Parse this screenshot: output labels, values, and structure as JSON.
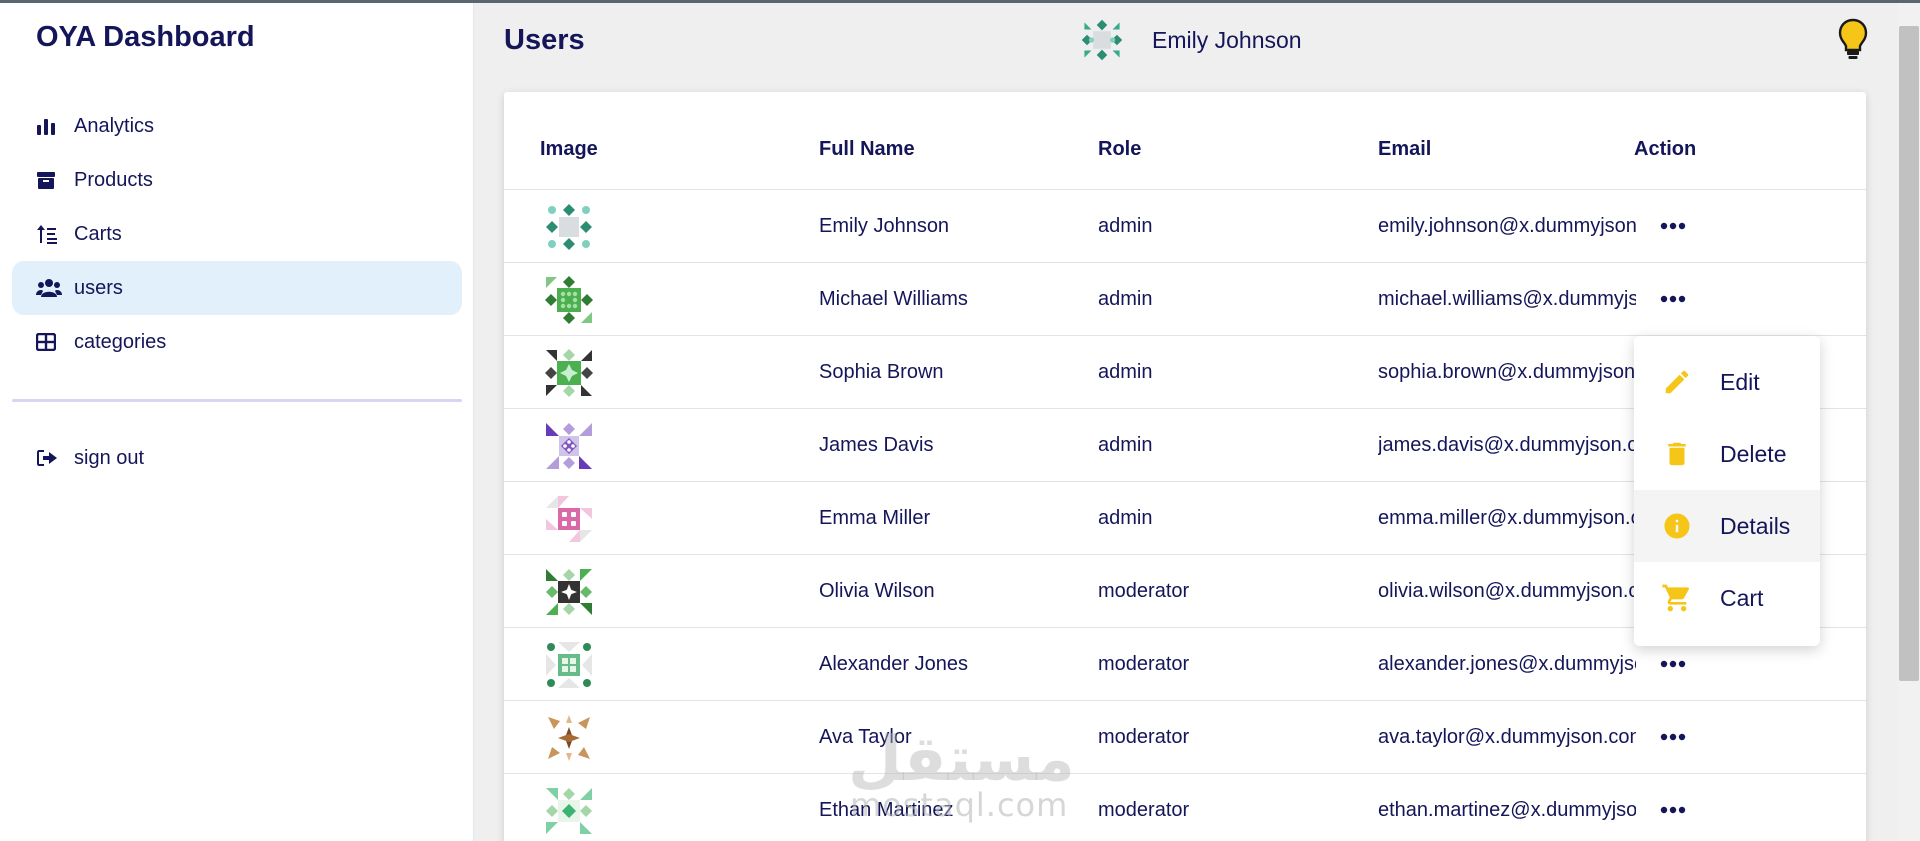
{
  "app": {
    "title": "OYA Dashboard"
  },
  "sidebar": {
    "items": [
      {
        "label": "Analytics",
        "icon": "bar-chart-icon"
      },
      {
        "label": "Products",
        "icon": "box-icon"
      },
      {
        "label": "Carts",
        "icon": "sort-icon"
      },
      {
        "label": "users",
        "icon": "users-icon",
        "active": true
      },
      {
        "label": "categories",
        "icon": "grid-icon"
      }
    ],
    "signout": {
      "label": "sign out",
      "icon": "sign-out-icon"
    }
  },
  "header": {
    "title": "Users",
    "user_name": "Emily Johnson"
  },
  "table": {
    "columns": [
      "Image",
      "Full Name",
      "Role",
      "Email",
      "Action"
    ],
    "rows": [
      {
        "name": "Emily Johnson",
        "role": "admin",
        "email": "emily.johnson@x.dummyjson.com"
      },
      {
        "name": "Michael Williams",
        "role": "admin",
        "email": "michael.williams@x.dummyjson.com"
      },
      {
        "name": "Sophia Brown",
        "role": "admin",
        "email": "sophia.brown@x.dummyjson.com"
      },
      {
        "name": "James Davis",
        "role": "admin",
        "email": "james.davis@x.dummyjson.com"
      },
      {
        "name": "Emma Miller",
        "role": "admin",
        "email": "emma.miller@x.dummyjson.com"
      },
      {
        "name": "Olivia Wilson",
        "role": "moderator",
        "email": "olivia.wilson@x.dummyjson.com"
      },
      {
        "name": "Alexander Jones",
        "role": "moderator",
        "email": "alexander.jones@x.dummyjson.com"
      },
      {
        "name": "Ava Taylor",
        "role": "moderator",
        "email": "ava.taylor@x.dummyjson.com"
      },
      {
        "name": "Ethan Martinez",
        "role": "moderator",
        "email": "ethan.martinez@x.dummyjson.com"
      }
    ]
  },
  "menu": {
    "items": [
      {
        "label": "Edit",
        "icon": "pencil-icon"
      },
      {
        "label": "Delete",
        "icon": "trash-icon"
      },
      {
        "label": "Details",
        "icon": "info-icon"
      },
      {
        "label": "Cart",
        "icon": "cart-icon"
      }
    ]
  },
  "watermark": {
    "arabic": "مستقل",
    "latin": "mostaql.com"
  },
  "colors": {
    "accent": "#141659",
    "active_bg": "#e1f0fb",
    "menu_icon": "#f5c518"
  }
}
